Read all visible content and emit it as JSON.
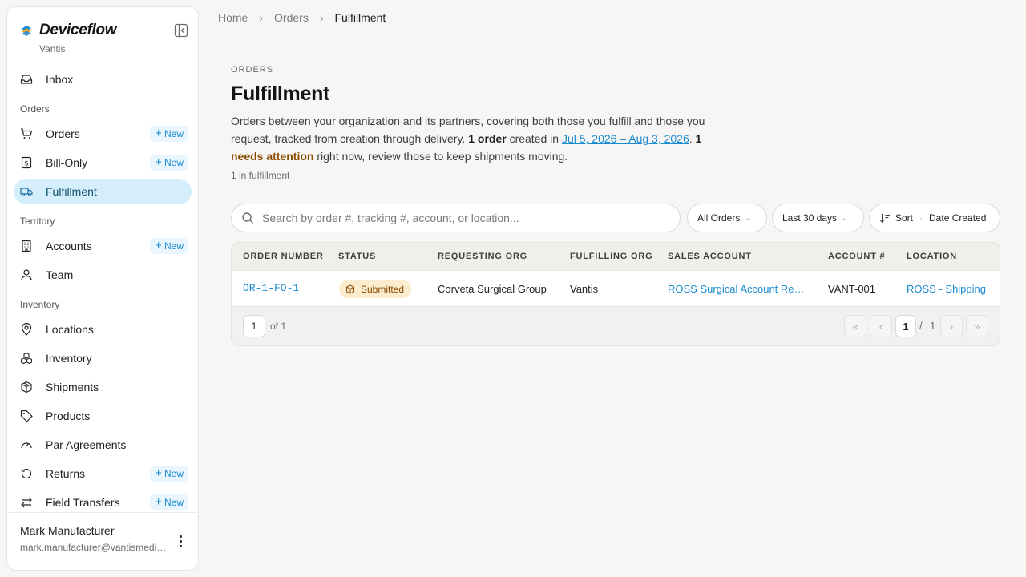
{
  "brand": {
    "name": "Deviceflow",
    "org": "Vantis"
  },
  "sidebar": {
    "inbox": "Inbox",
    "sections": {
      "orders": "Orders",
      "territory": "Territory",
      "inventory": "Inventory"
    },
    "items": {
      "orders": "Orders",
      "bill_only": "Bill-Only",
      "fulfillment": "Fulfillment",
      "accounts": "Accounts",
      "team": "Team",
      "locations": "Locations",
      "inventory": "Inventory",
      "shipments": "Shipments",
      "products": "Products",
      "par_agreements": "Par Agreements",
      "returns": "Returns",
      "field_transfers": "Field Transfers"
    },
    "new_label": "New",
    "active": "fulfillment"
  },
  "user": {
    "name": "Mark Manufacturer",
    "email": "mark.manufacturer@vantismedical.com"
  },
  "breadcrumb": {
    "home": "Home",
    "orders": "Orders",
    "current": "Fulfillment"
  },
  "header": {
    "eyebrow": "ORDERS",
    "title": "Fulfillment",
    "desc_part1": "Orders between your organization and its partners, covering both those you fulfill and those you request, tracked from creation through delivery. ",
    "desc_count": "1 order",
    "desc_part2": " created in ",
    "desc_range": "Jul 5, 2026 – Aug 3, 2026",
    "desc_part3": ". ",
    "desc_attn_num": "1",
    "desc_attn": "needs attention",
    "desc_part4": " right now, review those to keep shipments moving.",
    "subcount": "1 in fulfillment"
  },
  "search": {
    "placeholder": "Search by order #, tracking #, account, or location..."
  },
  "filters": {
    "scope": "All Orders",
    "range": "Last 30 days",
    "sort_label": "Sort",
    "sort_value": "Date Created"
  },
  "table": {
    "columns": [
      "ORDER NUMBER",
      "STATUS",
      "REQUESTING ORG",
      "FULFILLING ORG",
      "SALES ACCOUNT",
      "ACCOUNT #",
      "LOCATION"
    ],
    "rows": [
      {
        "order_number": "OR-1-FO-1",
        "status": "Submitted",
        "requesting_org": "Corveta Surgical Group",
        "fulfilling_org": "Vantis",
        "sales_account": "ROSS Surgical Account Request",
        "account_no": "VANT-001",
        "location": "ROSS - Shipping"
      }
    ]
  },
  "pagination": {
    "page": "1",
    "of_label": "of 1",
    "current": "1",
    "slash": "/",
    "total": "1"
  },
  "colors": {
    "accent": "#1a8bd0",
    "active_bg": "#d5eefb",
    "badge_bg": "#fbeccd",
    "badge_text": "#8a4a00"
  }
}
